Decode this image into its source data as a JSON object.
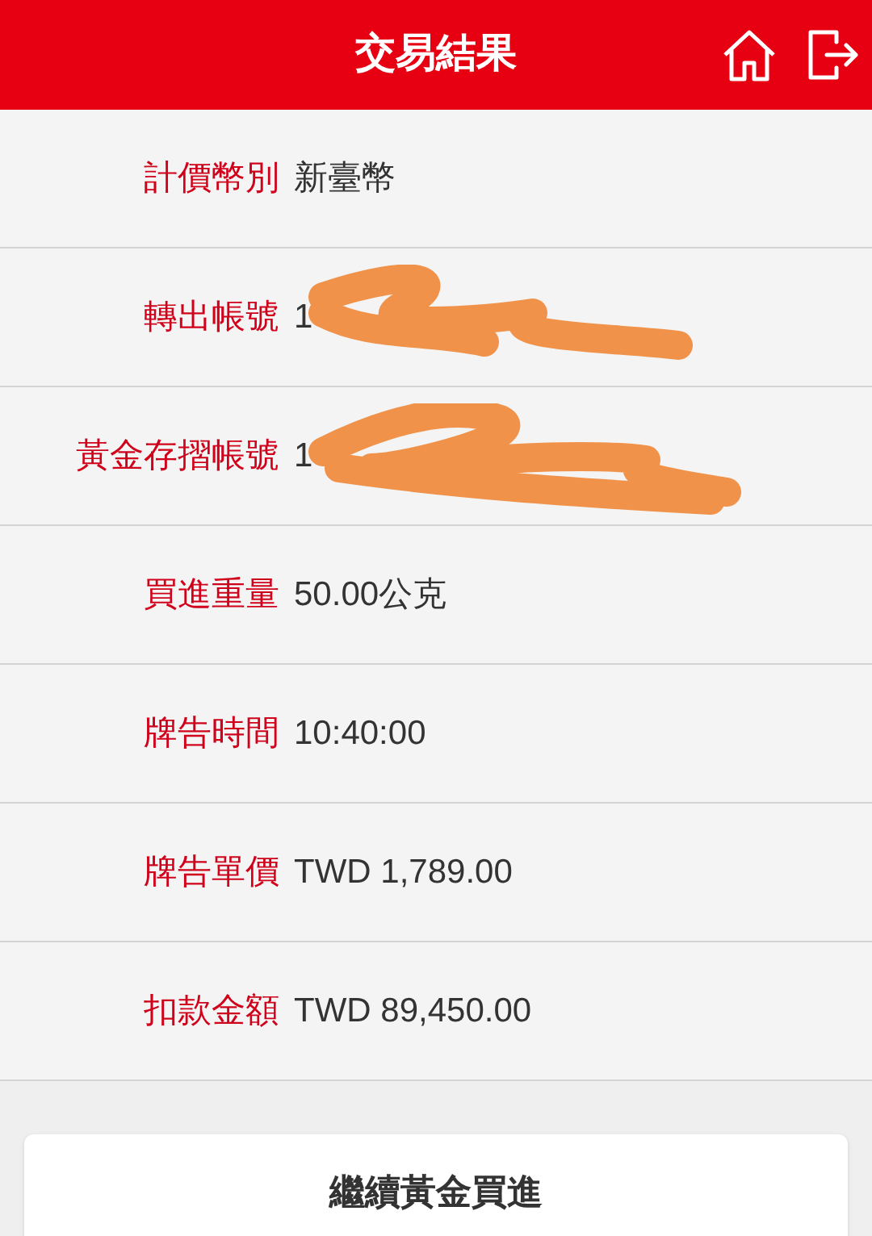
{
  "header": {
    "title": "交易結果"
  },
  "rows": [
    {
      "label": "計價幣別",
      "value": "新臺幣",
      "redacted": false
    },
    {
      "label": "轉出帳號",
      "value": "1",
      "redacted": true
    },
    {
      "label": "黃金存摺帳號",
      "value": "1",
      "redacted": true
    },
    {
      "label": "買進重量",
      "value": "50.00公克",
      "redacted": false
    },
    {
      "label": "牌告時間",
      "value": "10:40:00",
      "redacted": false
    },
    {
      "label": "牌告單價",
      "value": "TWD 1,789.00",
      "redacted": false
    },
    {
      "label": "扣款金額",
      "value": "TWD 89,450.00",
      "redacted": false
    }
  ],
  "button": "繼續黃金買進"
}
